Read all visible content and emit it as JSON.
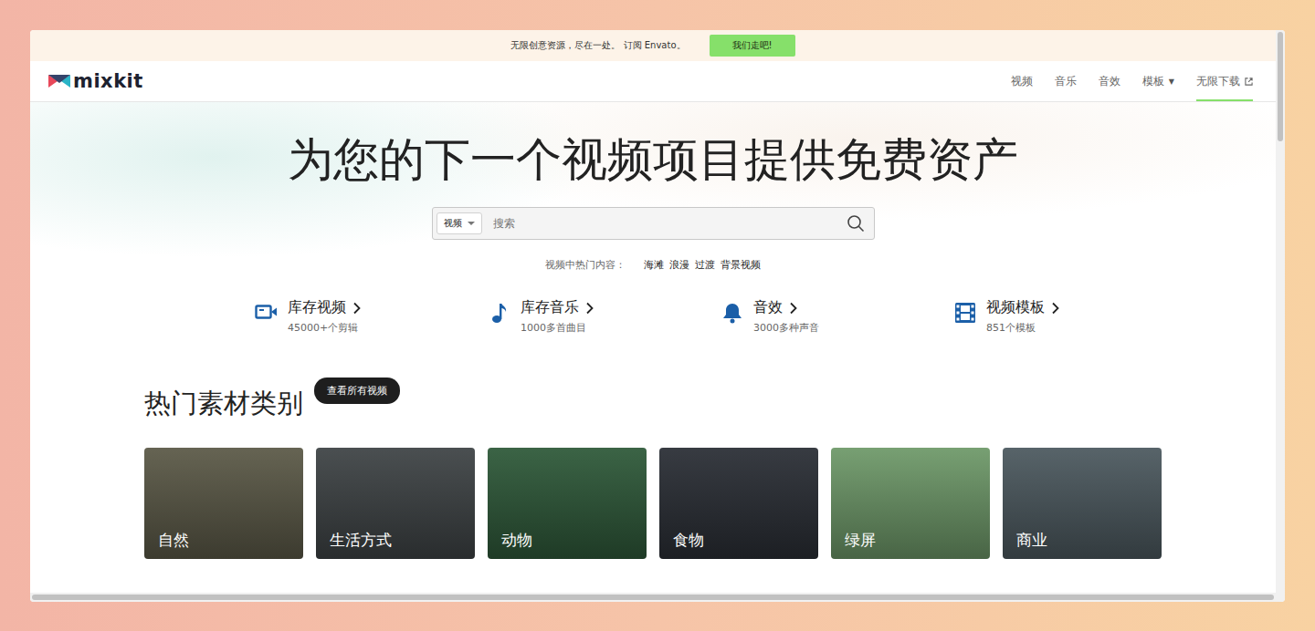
{
  "banner": {
    "text": "无限创意资源，尽在一处。 订阅 Envato。",
    "button": "我们走吧!"
  },
  "logo": {
    "text": "mixkit"
  },
  "nav": [
    {
      "label": "视频",
      "selected": false,
      "kind": "link"
    },
    {
      "label": "音乐",
      "selected": false,
      "kind": "link"
    },
    {
      "label": "音效",
      "selected": false,
      "kind": "link"
    },
    {
      "label": "模板",
      "selected": false,
      "kind": "dropdown",
      "caret": "▼"
    },
    {
      "label": "无限下载",
      "selected": true,
      "kind": "external"
    }
  ],
  "hero": {
    "title": "为您的下一个视频项目提供免费资产"
  },
  "search": {
    "scope": "视频",
    "placeholder": "搜索"
  },
  "popular": {
    "label": "视频中热门内容：",
    "tags": [
      "海滩",
      "浪漫",
      "过渡",
      "背景视频"
    ]
  },
  "categories": [
    {
      "title": "库存视频",
      "count": "45000+个剪辑",
      "kind": "video"
    },
    {
      "title": "库存音乐",
      "count": "1000多首曲目",
      "kind": "music"
    },
    {
      "title": "音效",
      "count": "3000多种声音",
      "kind": "sound"
    },
    {
      "title": "视频模板",
      "count": "851个模板",
      "kind": "template"
    }
  ],
  "section": {
    "title": "热门素材类别",
    "button": "查看所有视频"
  },
  "cards": [
    {
      "label": "自然",
      "color": "#5c5a48"
    },
    {
      "label": "生活方式",
      "color": "#3f4446"
    },
    {
      "label": "动物",
      "color": "#2f5a3a"
    },
    {
      "label": "食物",
      "color": "#2b2f36"
    },
    {
      "label": "绿屏",
      "color": "#6f9a6a"
    },
    {
      "label": "商业",
      "color": "#4d5a60"
    }
  ]
}
